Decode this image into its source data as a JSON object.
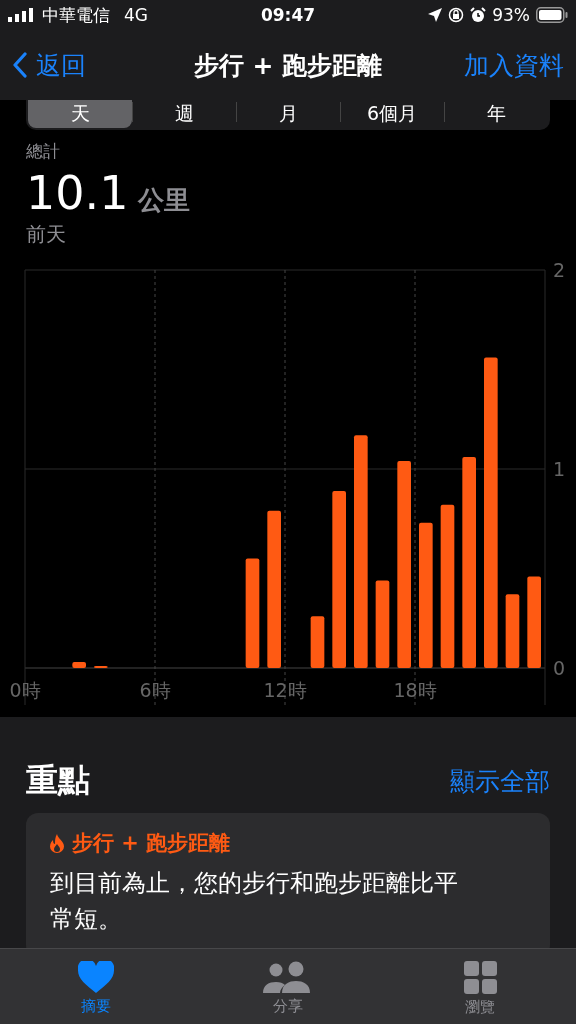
{
  "status_bar": {
    "carrier": "中華電信",
    "network": "4G",
    "time": "09:47",
    "battery": "93%"
  },
  "nav": {
    "back": "返回",
    "title": "步行 + 跑步距離",
    "action": "加入資料"
  },
  "periods": [
    {
      "label": "天",
      "selected": true
    },
    {
      "label": "週",
      "selected": false
    },
    {
      "label": "月",
      "selected": false
    },
    {
      "label": "6個月",
      "selected": false
    },
    {
      "label": "年",
      "selected": false
    }
  ],
  "summary": {
    "label": "總計",
    "value": "10.1",
    "unit": "公里",
    "date": "前天"
  },
  "chart": {
    "chart_data": {
      "type": "bar",
      "x": [
        2.5,
        3.5,
        10.5,
        11.5,
        13.5,
        14.5,
        15.5,
        16.5,
        17.5,
        18.5,
        19.5,
        20.5,
        21.5,
        22.5,
        23.5
      ],
      "xlim": [
        0,
        24
      ],
      "series": [
        {
          "color": "#ff5a13",
          "values": [
            0.03,
            0.01,
            0.55,
            0.79,
            0.26,
            0.89,
            1.17,
            0.44,
            1.04,
            0.73,
            0.82,
            1.06,
            1.56,
            0.37,
            0.46
          ]
        }
      ],
      "ylim": [
        0,
        2
      ],
      "grid": true,
      "ref_lines": [
        {
          "axis": "y",
          "value": 1
        }
      ],
      "yticks": [
        0,
        1,
        2
      ],
      "xticks": [
        {
          "value": 0,
          "label": "0時"
        },
        {
          "value": 6,
          "label": "6時"
        },
        {
          "value": 12,
          "label": "12時"
        },
        {
          "value": 18,
          "label": "18時"
        }
      ]
    }
  },
  "highlights": {
    "title": "重點",
    "show_all": "顯示全部",
    "cards": [
      {
        "title": "步行 + 跑步距離",
        "text": "到目前為止，您的步行和跑步距離比平常短。"
      }
    ]
  },
  "tab_bar": [
    {
      "kind": "heart",
      "label": "摘要",
      "selected": true
    },
    {
      "kind": "people",
      "label": "分享",
      "selected": false
    },
    {
      "kind": "grid",
      "label": "瀏覽",
      "selected": false
    }
  ]
}
